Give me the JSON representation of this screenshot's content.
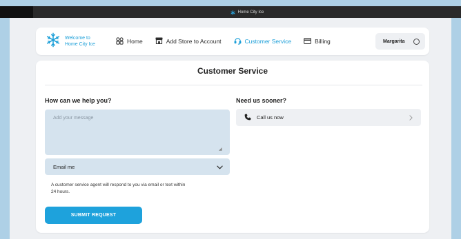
{
  "window": {
    "title": "Home City Ice"
  },
  "nav": {
    "logo_line1": "Welcome to",
    "logo_line2": "Home City Ice",
    "items": [
      {
        "label": "Home",
        "icon": "grid-icon"
      },
      {
        "label": "Add Store to Account",
        "icon": "store-icon"
      },
      {
        "label": "Customer Service",
        "icon": "headset-icon"
      },
      {
        "label": "Billing",
        "icon": "card-icon"
      }
    ],
    "user_name": "Margarita"
  },
  "page": {
    "title": "Customer Service",
    "help_heading": "How can we help you?",
    "message_placeholder": "Add your message",
    "message_value": "",
    "contact_method": "Email me",
    "note": "A customer service agent will respond to you via email or text within 24 hours.",
    "submit_label": "SUBMIT REQUEST",
    "sooner_heading": "Need us sooner?",
    "call_label": "Call us now"
  },
  "colors": {
    "accent": "#1a9ed8",
    "background": "#aed0e6",
    "input_fill": "#d5e3ee"
  }
}
